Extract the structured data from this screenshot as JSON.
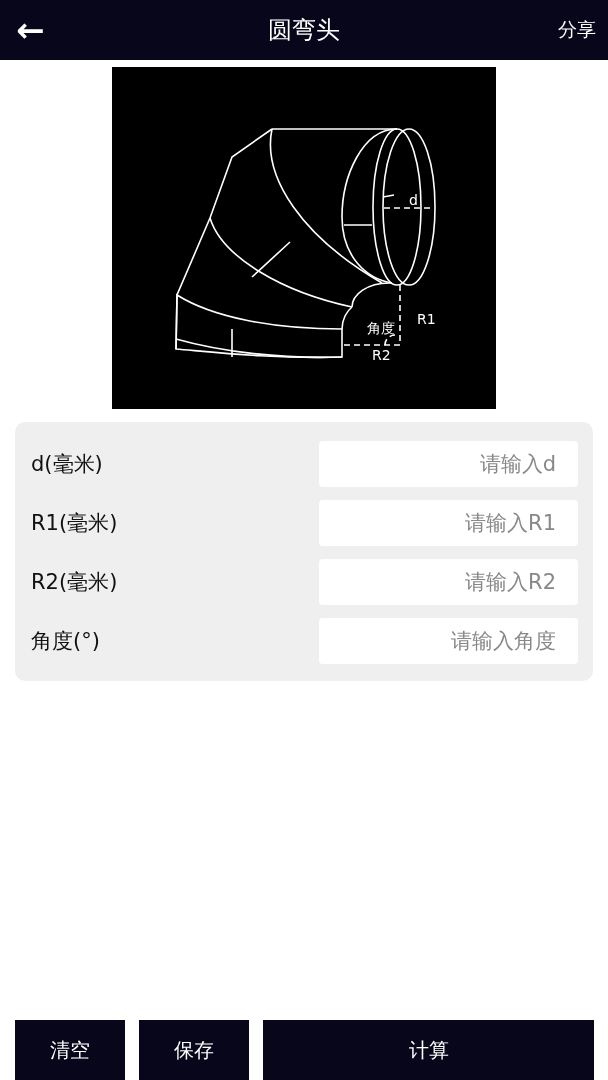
{
  "header": {
    "back": "←",
    "title": "圆弯头",
    "share": "分享"
  },
  "diagram": {
    "labels": [
      {
        "kind": "d",
        "text": "d"
      },
      {
        "kind": "r1",
        "text": "R1"
      },
      {
        "kind": "angle",
        "text": "角度"
      },
      {
        "kind": "r2",
        "text": "R2"
      }
    ]
  },
  "fields": [
    {
      "label": "d(毫米)",
      "placeholder": "请输入d"
    },
    {
      "label": "R1(毫米)",
      "placeholder": "请输入R1"
    },
    {
      "label": "R2(毫米)",
      "placeholder": "请输入R2"
    },
    {
      "label": "角度(°)",
      "placeholder": "请输入角度"
    }
  ],
  "buttons": [
    {
      "kind": "clear",
      "label": "清空"
    },
    {
      "kind": "save",
      "label": "保存"
    },
    {
      "kind": "calc",
      "label": "计算"
    }
  ]
}
